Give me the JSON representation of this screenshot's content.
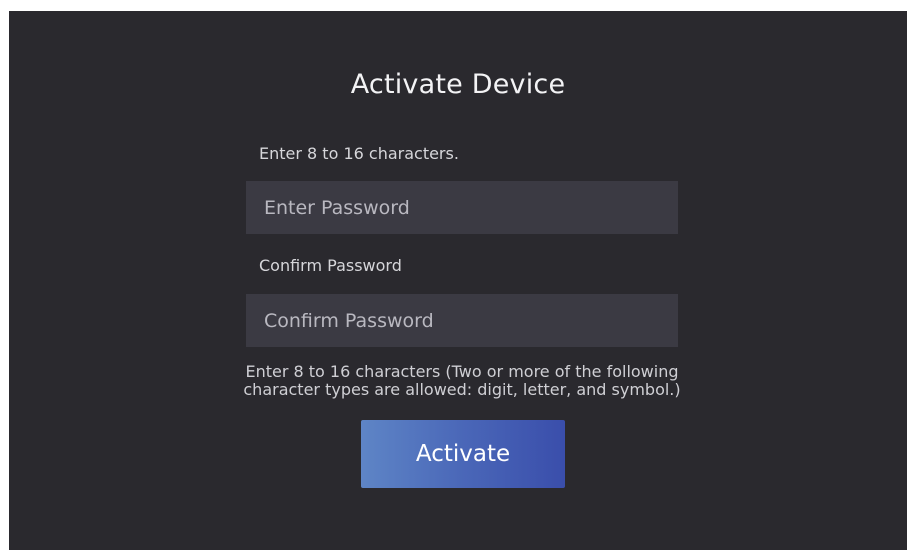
{
  "screen": {
    "title": "Activate Device",
    "password_label": "Enter 8 to 16 characters.",
    "password_placeholder": "Enter Password",
    "confirm_label": "Confirm Password",
    "confirm_placeholder": "Confirm Password",
    "hint_line1": "Enter 8 to 16 characters (Two or more of the following",
    "hint_line2": "character types are allowed: digit, letter, and symbol.)",
    "activate_label": "Activate"
  },
  "colors": {
    "background": "#2a292e",
    "field": "#3b3a43",
    "button_start": "#5e85c6",
    "button_end": "#3a4eab"
  }
}
